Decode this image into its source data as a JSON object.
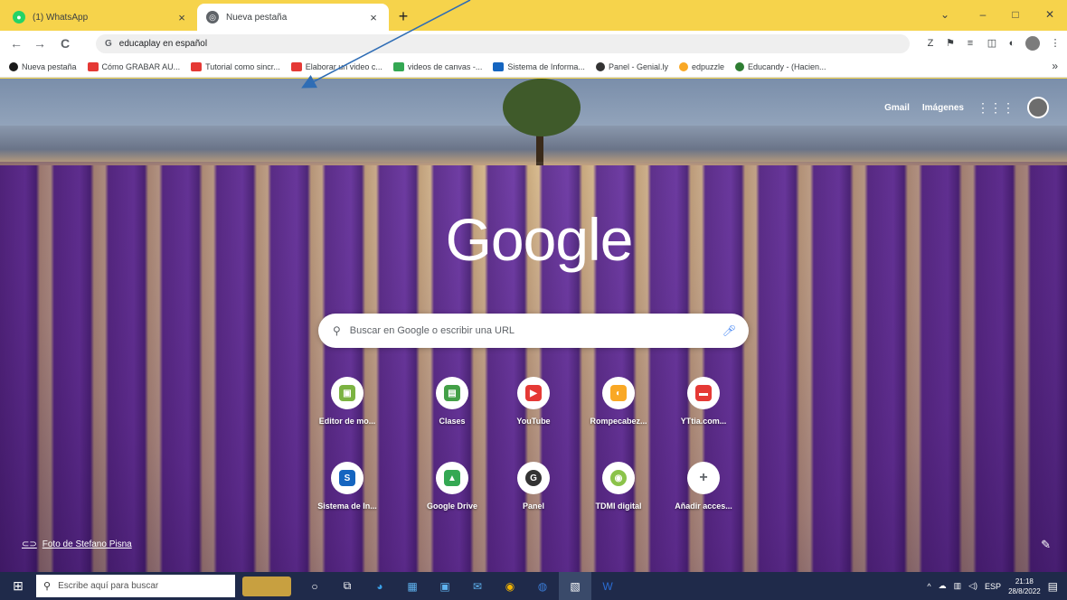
{
  "tabs": [
    {
      "title": "(1) WhatsApp",
      "favicon_color": "#25d366",
      "active": false
    },
    {
      "title": "Nueva pestaña",
      "favicon_color": "#5f6368",
      "active": true
    }
  ],
  "window_controls": {
    "minimize": "–",
    "maximize": "□",
    "close": "✕",
    "chevron": "⌄"
  },
  "toolbar": {
    "back": "←",
    "forward": "→",
    "reload": "C",
    "omnibox_icon": "G",
    "omnibox_text": "educaplay en español"
  },
  "bookmarks": [
    {
      "label": "Nueva pestaña",
      "color": "#1a1a1a"
    },
    {
      "label": "Cómo GRABAR AU...",
      "color": "#e53935"
    },
    {
      "label": "Tutorial como sincr...",
      "color": "#e53935"
    },
    {
      "label": "Elaborar un video c...",
      "color": "#e53935"
    },
    {
      "label": "videos de canvas -...",
      "color": "#34a853"
    },
    {
      "label": "Sistema de Informa...",
      "color": "#1565c0"
    },
    {
      "label": "Panel - Genial.ly",
      "color": "#333333"
    },
    {
      "label": "edpuzzle",
      "color": "#f9a825"
    },
    {
      "label": "Educandy - (Hacien...",
      "color": "#2e7d32"
    }
  ],
  "ntp": {
    "gmail": "Gmail",
    "images": "Imágenes",
    "logo": "Google",
    "search_placeholder": "Buscar en Google o escribir una URL",
    "shortcuts": [
      {
        "label": "Editor de mo...",
        "color": "#7cb342",
        "glyph": "▣"
      },
      {
        "label": "Clases",
        "color": "#43a047",
        "glyph": "▤"
      },
      {
        "label": "YouTube",
        "color": "#e53935",
        "glyph": "▶"
      },
      {
        "label": "Rompecabez...",
        "color": "#f9a825",
        "glyph": "◐"
      },
      {
        "label": "YTtia.com...",
        "color": "#e53935",
        "glyph": "▬"
      },
      {
        "label": "Sistema de In...",
        "color": "#1565c0",
        "glyph": "S"
      },
      {
        "label": "Google Drive",
        "color": "#34a853",
        "glyph": "▲"
      },
      {
        "label": "Panel",
        "color": "#333333",
        "glyph": "G"
      },
      {
        "label": "TDMI digital",
        "color": "#8bc34a",
        "glyph": "◉"
      },
      {
        "label": "Añadir acces...",
        "color": "#5f6368",
        "glyph": "+"
      }
    ],
    "credit": "Foto de Stefano Pisna"
  },
  "taskbar": {
    "search_placeholder": "Escribe aquí para buscar",
    "lang": "ESP",
    "time": "21:18",
    "date": "28/8/2022"
  }
}
